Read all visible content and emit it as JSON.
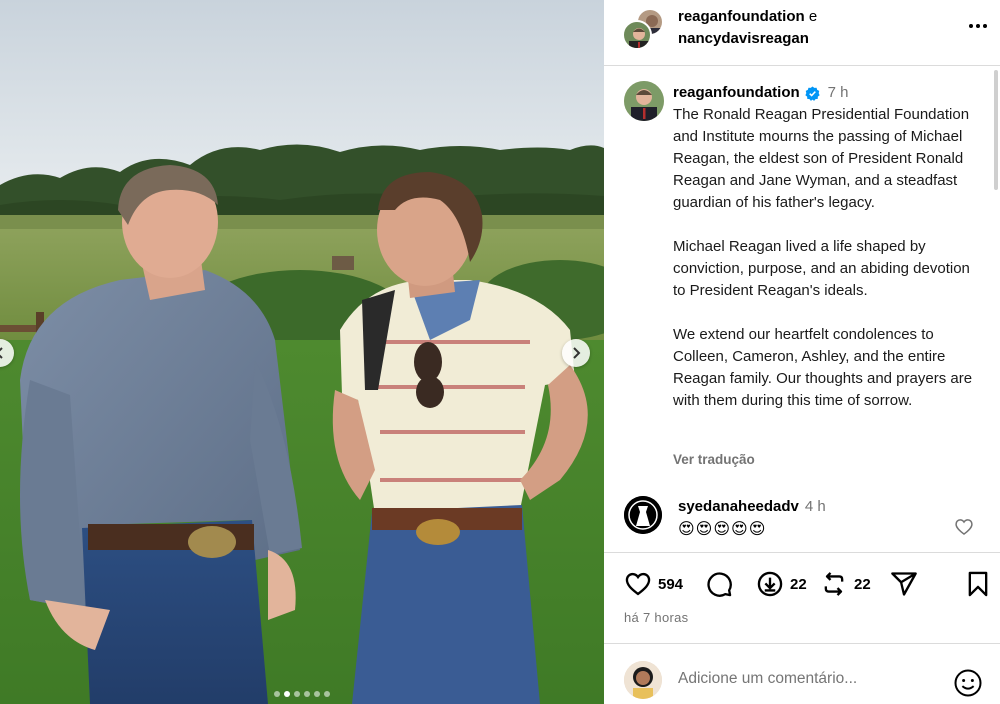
{
  "post": {
    "photo_alt": "",
    "carousel": {
      "total": 6,
      "active_index": 1
    }
  },
  "header": {
    "author1": "reaganfoundation",
    "connector": "e",
    "author2": "nancydavisreagan"
  },
  "caption": {
    "username": "reaganfoundation",
    "time": "7 h",
    "paragraphs": [
      "The Ronald Reagan Presidential Foundation and Institute mourns the passing of Michael Reagan, the eldest son of President Ronald Reagan and Jane Wyman, and a steadfast guardian of his father's legacy.",
      "Michael Reagan lived a life shaped by conviction, purpose, and an abiding devotion to President Reagan's ideals.",
      "We extend our heartfelt condolences to Colleen, Cameron, Ashley, and the entire Reagan family. Our thoughts and prayers are with them during this time of sorrow."
    ],
    "see_translation": "Ver tradução"
  },
  "comment": {
    "username": "syedanaheedadv",
    "time": "4 h",
    "text": "😍😍😍😍😍"
  },
  "actions": {
    "likes": "594",
    "shares_count": "22",
    "reposts_count": "22",
    "posted_ago": "há 7 horas"
  },
  "add_comment": {
    "placeholder": "Adicione um comentário..."
  },
  "colors": {
    "verified": "#0095f6",
    "muted": "#737373",
    "divider": "#dbdbdb"
  },
  "icons": [
    "heart-icon",
    "comment-icon",
    "download-icon",
    "repost-icon",
    "share-icon",
    "bookmark-icon",
    "emoji-icon",
    "more-icon",
    "verified-badge-icon"
  ]
}
